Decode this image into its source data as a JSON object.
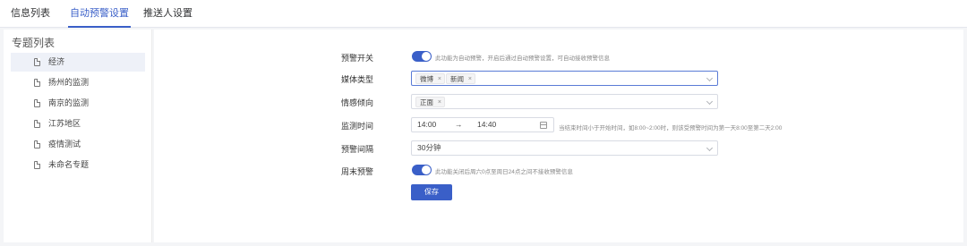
{
  "tabs": [
    {
      "label": "信息列表"
    },
    {
      "label": "自动预警设置"
    },
    {
      "label": "推送人设置"
    }
  ],
  "sidebar": {
    "title": "专题列表",
    "items": [
      {
        "label": "经济"
      },
      {
        "label": "扬州的监测"
      },
      {
        "label": "南京的监测"
      },
      {
        "label": "江苏地区"
      },
      {
        "label": "疫情测试"
      },
      {
        "label": "未命名专题"
      }
    ]
  },
  "form": {
    "alert_switch": {
      "label": "预警开关",
      "on": true,
      "hint": "此功能为自动预警，开启后通过自动预警设置，可自动接收预警信息"
    },
    "media_type": {
      "label": "媒体类型",
      "tags": [
        "微博",
        "新闻"
      ]
    },
    "sentiment": {
      "label": "情感倾向",
      "tags": [
        "正面"
      ]
    },
    "monitor_time": {
      "label": "监测时间",
      "start": "14:00",
      "separator": "→",
      "end": "14:40",
      "hint": "当结束时间小于开始时间，如8:00~2:00时，则该受预警时间为第一天8:00至第二天2:00"
    },
    "interval": {
      "label": "预警间隔",
      "value": "30分钟"
    },
    "weekend": {
      "label": "周末预警",
      "on": true,
      "hint": "此功能关闭后周六0点至周日24点之间不接收预警信息"
    },
    "save_label": "保存"
  },
  "colors": {
    "accent": "#3a5fc8",
    "active_row": "#eef1f8",
    "background": "#f4f5f7"
  },
  "icons": {
    "sidebar_item": "document-icon",
    "select": "chevron-down-icon",
    "time": "calendar-icon",
    "tag_remove": "close-icon"
  }
}
